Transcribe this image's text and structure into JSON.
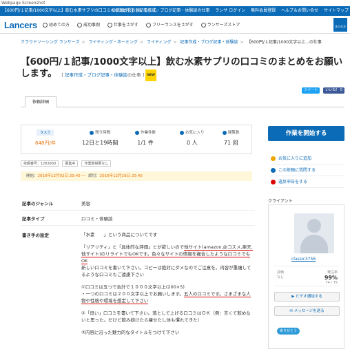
{
  "webpage_label": "Webpage Screenshot",
  "topbar": {
    "promo": "【600円/１記事/1000文字以上】飲む水素サプリの口コミのまとめをお願いします。",
    "links": [
      "の依頼/外注",
      "記事作成・ブログ記事・体験談の仕事",
      "ランサ ログイン",
      "無料会員登録",
      "ヘルプ＆お問い合せ",
      "サイトマップ"
    ]
  },
  "nav": {
    "logo": "Lancers",
    "items": [
      "初めての方",
      "成功事例",
      "仕事をさがす",
      "フリーランスをさがす",
      "ランサーズストア"
    ],
    "avatar_badge": "法人の方"
  },
  "breadcrumb": [
    "クラウドソーシング ランサーズ",
    "ライティング・ネーミング",
    "ライティング",
    "記事作成・ブログ記事・体験談",
    "【600円/１記事/1000文字以上...の仕事"
  ],
  "title": "【600円/１記事/1000文字以上】飲む水素サプリの口コミのまとめをお願いします。",
  "category_link": "記事作成・ブログ記事・体験談",
  "category_suffix": "の仕事",
  "new_badge": "NEW",
  "share": {
    "tweet": "ツイート",
    "like": "いいね！ 0"
  },
  "tab_label": "依頼詳細",
  "stats": {
    "task_label": "タスク",
    "task_value": "648円/件",
    "remaining_label": "残り時間",
    "remaining_value": "12日と19時間",
    "progress_label": "作業件数",
    "progress_value": "1/1 件",
    "favorites_label": "お気に入り",
    "favorites_value": "0 人",
    "views_label": "閲覧数",
    "views_value": "71 回"
  },
  "cta": "作業を開始する",
  "side_links": [
    "お気に入りに追加",
    "この依頼に質問する",
    "違反申告をする"
  ],
  "tags": [
    "依頼番号：1263930",
    "募集中",
    "作業数制限なし"
  ],
  "dates": {
    "start_label": "開始：",
    "start_value": "2016年12月02日 20:40",
    "deadline_label": "締切：",
    "deadline_value": "2016年12月16日 20:40"
  },
  "client": {
    "label": "クライアント",
    "name": "classic3756",
    "rating_label": "評価",
    "rating_value": "なし",
    "order_rate_label": "発注率",
    "order_rate_value": "99%",
    "order_count": "74 / 75",
    "video_button": "ビデオ通話する",
    "message_button": "メッセージを送る",
    "thanks": "ありがとう"
  },
  "details": {
    "genre_label": "記事のジャンル",
    "genre_value": "美容",
    "type_label": "記事タイプ",
    "type_value": "口コミ・体験談",
    "method_label": "書き手の設定",
    "body": {
      "p1": "「水素　　」という商品についてです",
      "p2a": "「リアリティ」と「具体的な評価」とが欲しいので",
      "p2b": "他サイト(amazon,@コスメ,楽天,他サイト)のリライトでもOKです。",
      "p2c": "色々なサイトの情報を複合したような口コミでもOK",
      "p3": "新しい口コミを書いて下さい。コピーは絶対にダメなのでご注意を。内容が重複してるような口コミもご遠慮下さい",
      "p4a": "①口コミは五つで合計で１０００文字以上(200×5)",
      "p4b": "・一つの口コミは２００文字以上でお願いします。",
      "p4c": "五人の口コミです。さまざまな人物や性格や環境を想定して下さい",
      "p5": "②「良い」口コミを書いて下さい。落として上げる口コミはＯＫ（例：言くて飲めないと思った。だけど飲み続けたら痩せたし体も慣れてきた）",
      "p6": "③内容に沿った魅力的なタイトルをつけて下さい"
    }
  },
  "colors": {
    "brand": "#0b6bb7",
    "accent": "#e8710a",
    "underline": "#d00000"
  }
}
